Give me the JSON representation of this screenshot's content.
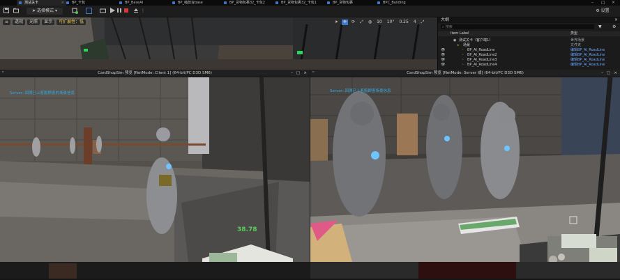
{
  "tabs": [
    {
      "label": "测试关卡",
      "active": true
    },
    {
      "label": "BP_卡包",
      "active": false
    },
    {
      "label": "BP_BaseAI",
      "active": false
    },
    {
      "label": "BP_缩放台base",
      "active": false
    },
    {
      "label": "BP_货物包裹32_卡包2",
      "active": false
    },
    {
      "label": "BP_货物包裹32_卡包1",
      "active": false
    },
    {
      "label": "BP_货物包裹",
      "active": false
    },
    {
      "label": "BPC_Building",
      "active": false
    }
  ],
  "toolbar": {
    "mode_label": "选择模式",
    "settings_label": "设置"
  },
  "viewport": {
    "perspective_label": "透视",
    "lit_label": "光照",
    "show_label": "显示",
    "scalability_label": "可扩展性：低",
    "grid_snap_value": "10",
    "rotation_snap_value": "10°",
    "scale_snap_value": "0.25",
    "camera_speed_value": "4"
  },
  "outliner": {
    "title": "大纲",
    "search_placeholder": "搜索",
    "col_label": "Item Label",
    "col_type": "类型",
    "rows": [
      {
        "label": "测试关卡（客户端1）",
        "type": "世界场景",
        "indent": 1
      },
      {
        "label": "场景",
        "type": "文件夹",
        "indent": 2
      },
      {
        "label": "BP_AI_RoadLine",
        "type": "编辑BP_AI_RoadLine",
        "indent": 3
      },
      {
        "label": "BP_AI_RoadLine2",
        "type": "编辑BP_AI_RoadLine",
        "indent": 3
      },
      {
        "label": "BP_AI_RoadLine3",
        "type": "编辑BP_AI_RoadLine",
        "indent": 3
      },
      {
        "label": "BP_AI_RoadLine4",
        "type": "编辑BP_AI_RoadLine",
        "indent": 3
      }
    ]
  },
  "client_window": {
    "title": "CardShopSim 预览 [NetMode: Client 1]  (64-bit/PC D3D SM6)",
    "debug_text": "Server: 回溯已上客服顾客的场景信息",
    "money_text": "38.78"
  },
  "server_window": {
    "title": "CardShopSim 预览 [NetMode: Server 或]  (64-bit/PC D3D SM6)",
    "debug_text": "Server: 回溯已上客服顾客场景信息"
  },
  "colors": {
    "accent_blue": "#3d78c9",
    "debug_cyan": "#36a9e1",
    "money_green": "#58d05a",
    "outliner_type_blue": "#6aa5ff",
    "scalability_yellow": "#e8c64a"
  }
}
